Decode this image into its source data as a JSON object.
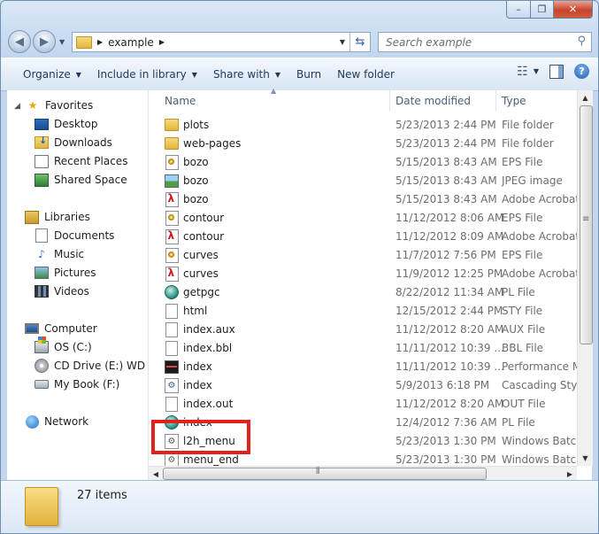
{
  "window": {
    "caption_min": "–",
    "caption_max": "❐",
    "caption_close": "✕"
  },
  "address": {
    "folder": "example",
    "search_placeholder": "Search example"
  },
  "toolbar": {
    "organize": "Organize",
    "include_in_library": "Include in library",
    "share_with": "Share with",
    "burn": "Burn",
    "new_folder": "New folder"
  },
  "sidebar": {
    "favorites": {
      "label": "Favorites",
      "items": [
        "Desktop",
        "Downloads",
        "Recent Places",
        "Shared Space"
      ]
    },
    "libraries": {
      "label": "Libraries",
      "items": [
        "Documents",
        "Music",
        "Pictures",
        "Videos"
      ]
    },
    "computer": {
      "label": "Computer",
      "items": [
        "OS (C:)",
        "CD Drive (E:) WD Sm",
        "My Book (F:)"
      ]
    },
    "network": {
      "label": "Network"
    }
  },
  "columns": {
    "name": "Name",
    "date_modified": "Date modified",
    "type": "Type"
  },
  "files": [
    {
      "name": "plots",
      "date": "5/23/2013 2:44 PM",
      "type": "File folder",
      "icon": "folder"
    },
    {
      "name": "web-pages",
      "date": "5/23/2013 2:44 PM",
      "type": "File folder",
      "icon": "folder"
    },
    {
      "name": "bozo",
      "date": "5/15/2013 8:43 AM",
      "type": "EPS File",
      "icon": "eps"
    },
    {
      "name": "bozo",
      "date": "5/15/2013 8:43 AM",
      "type": "JPEG image",
      "icon": "jpg"
    },
    {
      "name": "bozo",
      "date": "5/15/2013 8:43 AM",
      "type": "Adobe Acrobat D",
      "icon": "pdf"
    },
    {
      "name": "contour",
      "date": "11/12/2012 8:06 AM",
      "type": "EPS File",
      "icon": "eps"
    },
    {
      "name": "contour",
      "date": "11/12/2012 8:09 AM",
      "type": "Adobe Acrobat D",
      "icon": "pdf"
    },
    {
      "name": "curves",
      "date": "11/7/2012 7:56 PM",
      "type": "EPS File",
      "icon": "eps"
    },
    {
      "name": "curves",
      "date": "11/9/2012 12:25 PM",
      "type": "Adobe Acrobat D",
      "icon": "pdf"
    },
    {
      "name": "getpgc",
      "date": "8/22/2012 11:34 AM",
      "type": "PL File",
      "icon": "pl"
    },
    {
      "name": "html",
      "date": "12/15/2012 2:44 PM",
      "type": "STY File",
      "icon": "doc"
    },
    {
      "name": "index.aux",
      "date": "11/12/2012 8:20 AM",
      "type": "AUX File",
      "icon": "doc"
    },
    {
      "name": "index.bbl",
      "date": "11/11/2012 10:39 ...",
      "type": "BBL File",
      "icon": "doc"
    },
    {
      "name": "index",
      "date": "11/11/2012 10:39 ...",
      "type": "Performance Mo",
      "icon": "perf"
    },
    {
      "name": "index",
      "date": "5/9/2013 6:18 PM",
      "type": "Cascading Style",
      "icon": "gear"
    },
    {
      "name": "index.out",
      "date": "11/12/2012 8:20 AM",
      "type": "OUT File",
      "icon": "doc"
    },
    {
      "name": "index",
      "date": "12/4/2012 7:36 AM",
      "type": "PL File",
      "icon": "pl"
    },
    {
      "name": "l2h_menu",
      "date": "5/23/2013 1:30 PM",
      "type": "Windows Batch",
      "icon": "bat"
    },
    {
      "name": "menu_end",
      "date": "5/23/2013 1:30 PM",
      "type": "Windows Batch",
      "icon": "bat"
    }
  ],
  "status": {
    "item_count": "27 items"
  },
  "colors": {
    "highlight": "#e0211c",
    "window_frame": "#c2d6ee"
  }
}
